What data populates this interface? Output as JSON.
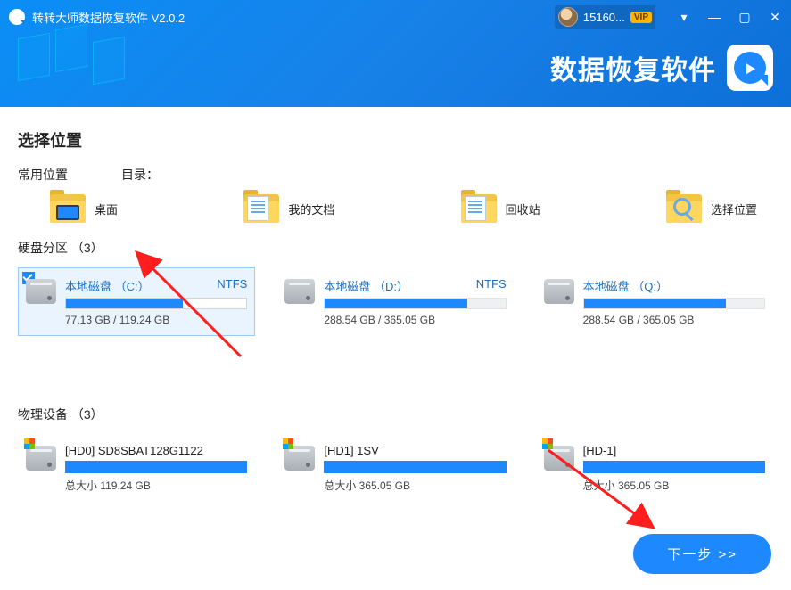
{
  "titlebar": {
    "app_title": "转转大师数据恢复软件 V2.0.2",
    "user_id": "15160...",
    "vip_label": "VIP"
  },
  "hero": {
    "brand_text": "数据恢复软件"
  },
  "sections": {
    "select_location": "选择位置",
    "common_location": "常用位置",
    "directory_label": "目录：",
    "partitions_title": "硬盘分区 （3）",
    "devices_title": "物理设备 （3）"
  },
  "quick": [
    {
      "label": "桌面"
    },
    {
      "label": "我的文档"
    },
    {
      "label": "回收站"
    },
    {
      "label": "选择位置"
    }
  ],
  "partitions": [
    {
      "name": "本地磁盘 （C:）",
      "fs": "NTFS",
      "used": "77.13 GB",
      "total": "119.24 GB",
      "pct": 64.7,
      "selected": true
    },
    {
      "name": "本地磁盘 （D:）",
      "fs": "NTFS",
      "used": "288.54 GB",
      "total": "365.05 GB",
      "pct": 79.0,
      "selected": false
    },
    {
      "name": "本地磁盘 （Q:）",
      "fs": "",
      "used": "288.54 GB",
      "total": "365.05 GB",
      "pct": 79.0,
      "selected": false
    }
  ],
  "devices": [
    {
      "name": "[HD0] SD8SBAT128G1122",
      "size_label": "总大小 119.24 GB"
    },
    {
      "name": "[HD1] 1SV",
      "size_label": "总大小 365.05 GB"
    },
    {
      "name": "[HD-1]",
      "size_label": "总大小 365.05 GB"
    }
  ],
  "footer": {
    "next_label": "下一步 >>"
  },
  "size_separator": " / "
}
